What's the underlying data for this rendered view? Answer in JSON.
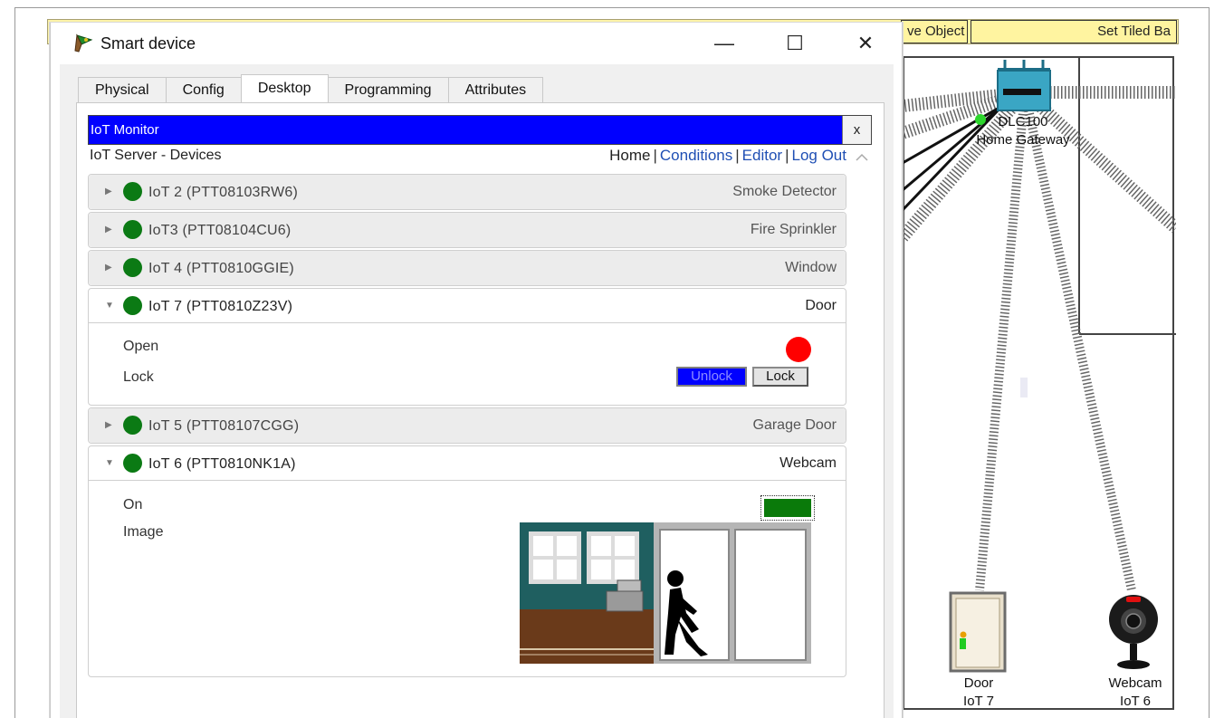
{
  "background": {
    "toolbar": {
      "buttons": [
        "ve Object",
        "Set Tiled Ba"
      ]
    },
    "gateway": {
      "name": "DLC100",
      "type": "Home Gateway"
    },
    "door_device": {
      "name": "Door",
      "id": "IoT 7"
    },
    "webcam_device": {
      "name": "Webcam",
      "id": "IoT 6"
    }
  },
  "window": {
    "title": "Smart device",
    "controls": {
      "minimize": "—",
      "maximize": "☐",
      "close": "✕"
    },
    "tabs": [
      {
        "label": "Physical"
      },
      {
        "label": "Config"
      },
      {
        "label": "Desktop",
        "active": true
      },
      {
        "label": "Programming"
      },
      {
        "label": "Attributes"
      }
    ]
  },
  "monitor": {
    "title": "IoT Monitor",
    "close_label": "x",
    "server_title": "IoT Server - Devices",
    "nav": {
      "home": "Home",
      "conditions": "Conditions",
      "editor": "Editor",
      "logout": "Log Out",
      "separator": "|"
    }
  },
  "devices": [
    {
      "name": "IoT 2 (PTT08103RW6)",
      "type": "Smoke Detector",
      "expanded": false,
      "status_color": "#0b7a14"
    },
    {
      "name": "IoT3 (PTT08104CU6)",
      "type": "Fire Sprinkler",
      "expanded": false,
      "status_color": "#0b7a14"
    },
    {
      "name": "IoT 4 (PTT0810GGIE)",
      "type": "Window",
      "expanded": false,
      "status_color": "#0b7a14"
    },
    {
      "name": "IoT 7 (PTT0810Z23V)",
      "type": "Door",
      "expanded": true,
      "status_color": "#0b7a14",
      "properties": {
        "open_label": "Open",
        "open_color": "#ff0000",
        "lock_label": "Lock",
        "unlock_button": "Unlock",
        "lock_button": "Lock"
      }
    },
    {
      "name": "IoT 5 (PTT08107CGG)",
      "type": "Garage Door",
      "expanded": false,
      "status_color": "#0b7a14"
    },
    {
      "name": "IoT 6 (PTT0810NK1A)",
      "type": "Webcam",
      "expanded": true,
      "status_color": "#0b7a14",
      "properties": {
        "on_label": "On",
        "on_color": "#0a7a0a",
        "image_label": "Image"
      }
    }
  ],
  "colors": {
    "monitor_bar": "#0000ff",
    "link": "#1f4fb4",
    "unlock_bg": "#0000ff"
  }
}
